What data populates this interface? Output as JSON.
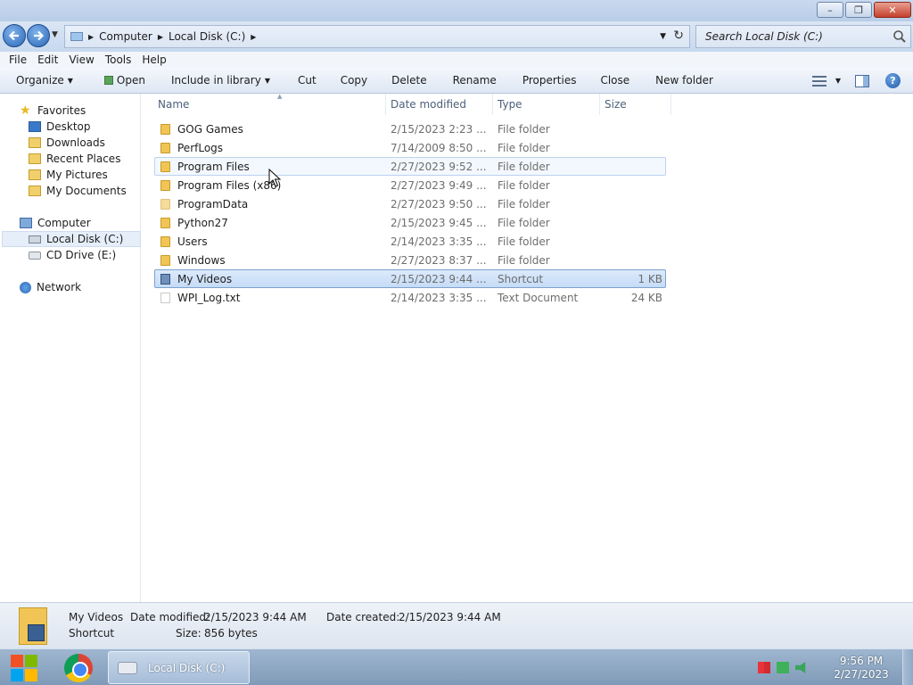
{
  "window": {
    "controls": {
      "minimize": "–",
      "restore": "❐",
      "close": "✕"
    }
  },
  "address": {
    "crumbs": [
      "Computer",
      "Local Disk (C:)"
    ],
    "search_placeholder": "Search Local Disk (C:)"
  },
  "menu": [
    "File",
    "Edit",
    "View",
    "Tools",
    "Help"
  ],
  "toolbar": {
    "organize": "Organize",
    "open": "Open",
    "include": "Include in library",
    "cut": "Cut",
    "copy": "Copy",
    "delete": "Delete",
    "rename": "Rename",
    "properties": "Properties",
    "close": "Close",
    "new_folder": "New folder"
  },
  "nav": {
    "favorites": "Favorites",
    "desktop": "Desktop",
    "downloads": "Downloads",
    "recent": "Recent Places",
    "pictures": "My Pictures",
    "documents": "My Documents",
    "computer": "Computer",
    "local_disk": "Local Disk (C:)",
    "cd_drive": "CD Drive (E:)",
    "network": "Network"
  },
  "columns": {
    "name": "Name",
    "date": "Date modified",
    "type": "Type",
    "size": "Size"
  },
  "files": [
    {
      "name": "GOG Games",
      "date": "2/15/2023 2:23 ...",
      "type": "File folder",
      "size": ""
    },
    {
      "name": "PerfLogs",
      "date": "7/14/2009 8:50 ...",
      "type": "File folder",
      "size": ""
    },
    {
      "name": "Program Files",
      "date": "2/27/2023 9:52 ...",
      "type": "File folder",
      "size": ""
    },
    {
      "name": "Program Files (x86)",
      "date": "2/27/2023 9:49 ...",
      "type": "File folder",
      "size": ""
    },
    {
      "name": "ProgramData",
      "date": "2/27/2023 9:50 ...",
      "type": "File folder",
      "size": ""
    },
    {
      "name": "Python27",
      "date": "2/15/2023 9:45 ...",
      "type": "File folder",
      "size": ""
    },
    {
      "name": "Users",
      "date": "2/14/2023 3:35 ...",
      "type": "File folder",
      "size": ""
    },
    {
      "name": "Windows",
      "date": "2/27/2023 8:37 ...",
      "type": "File folder",
      "size": ""
    },
    {
      "name": "My Videos",
      "date": "2/15/2023 9:44 ...",
      "type": "Shortcut",
      "size": "1 KB"
    },
    {
      "name": "WPI_Log.txt",
      "date": "2/14/2023 3:35 ...",
      "type": "Text Document",
      "size": "24 KB"
    }
  ],
  "details": {
    "name": "My Videos",
    "date_modified_label": "Date modified:",
    "date_modified": "2/15/2023 9:44 AM",
    "date_created_label": "Date created:",
    "date_created": "2/15/2023 9:44 AM",
    "type": "Shortcut",
    "size_label": "Size:",
    "size": "856 bytes"
  },
  "taskbar": {
    "explorer_label": "Local Disk (C:)",
    "time": "9:56 PM",
    "date": "2/27/2023"
  }
}
